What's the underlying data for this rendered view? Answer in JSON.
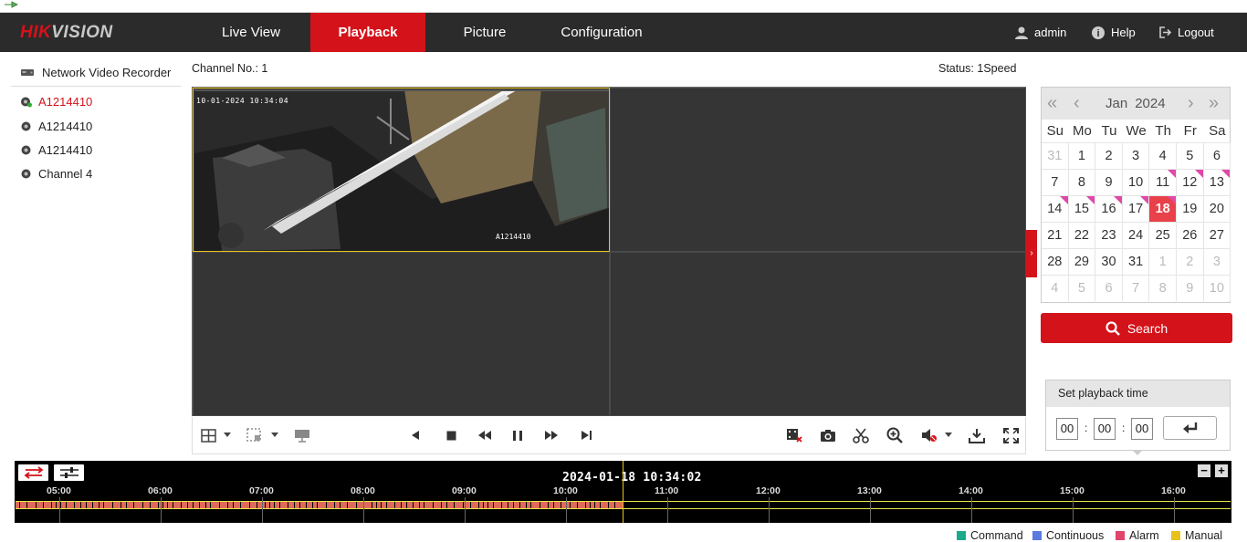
{
  "brand": {
    "logo": "HIKVISION"
  },
  "nav": {
    "tabs": [
      {
        "label": "Live View"
      },
      {
        "label": "Playback"
      },
      {
        "label": "Picture"
      },
      {
        "label": "Configuration"
      }
    ],
    "user": "admin",
    "help": "Help",
    "logout": "Logout"
  },
  "tree": {
    "root": "Network Video Recorder",
    "items": [
      {
        "label": "A1214410"
      },
      {
        "label": "A1214410"
      },
      {
        "label": "A1214410"
      },
      {
        "label": "Channel 4"
      }
    ]
  },
  "channel_no": "Channel No.: 1",
  "status": "Status: 1Speed",
  "video": {
    "osd_time": "10-01-2024 10:34:04",
    "osd_name": "A1214410"
  },
  "calendar": {
    "month": "Jan",
    "year": "2024",
    "weekdays": [
      "Su",
      "Mo",
      "Tu",
      "We",
      "Th",
      "Fr",
      "Sa"
    ],
    "days": [
      {
        "d": "31",
        "other": true
      },
      {
        "d": "1"
      },
      {
        "d": "2"
      },
      {
        "d": "3"
      },
      {
        "d": "4"
      },
      {
        "d": "5"
      },
      {
        "d": "6"
      },
      {
        "d": "7"
      },
      {
        "d": "8"
      },
      {
        "d": "9"
      },
      {
        "d": "10"
      },
      {
        "d": "11",
        "rec": true
      },
      {
        "d": "12",
        "rec": true
      },
      {
        "d": "13",
        "rec": true
      },
      {
        "d": "14",
        "rec": true
      },
      {
        "d": "15",
        "rec": true
      },
      {
        "d": "16",
        "rec": true
      },
      {
        "d": "17",
        "rec": true
      },
      {
        "d": "18",
        "rec": true,
        "selected": true
      },
      {
        "d": "19"
      },
      {
        "d": "20"
      },
      {
        "d": "21"
      },
      {
        "d": "22"
      },
      {
        "d": "23"
      },
      {
        "d": "24"
      },
      {
        "d": "25"
      },
      {
        "d": "26"
      },
      {
        "d": "27"
      },
      {
        "d": "28"
      },
      {
        "d": "29"
      },
      {
        "d": "30"
      },
      {
        "d": "31"
      },
      {
        "d": "1",
        "other": true
      },
      {
        "d": "2",
        "other": true
      },
      {
        "d": "3",
        "other": true
      },
      {
        "d": "4",
        "other": true
      },
      {
        "d": "5",
        "other": true
      },
      {
        "d": "6",
        "other": true
      },
      {
        "d": "7",
        "other": true
      },
      {
        "d": "8",
        "other": true
      },
      {
        "d": "9",
        "other": true
      },
      {
        "d": "10",
        "other": true
      }
    ]
  },
  "search": {
    "label": "Search"
  },
  "playback_time": {
    "title": "Set playback time",
    "hh": "00",
    "mm": "00",
    "ss": "00",
    "sep": ":"
  },
  "timeline": {
    "current": "2024-01-18 10:34:02",
    "hours": [
      "05:00",
      "06:00",
      "07:00",
      "08:00",
      "09:00",
      "10:00",
      "11:00",
      "12:00",
      "13:00",
      "14:00",
      "15:00",
      "16:00"
    ],
    "zoom_out": "−",
    "zoom_in": "+"
  },
  "legend": [
    {
      "label": "Command",
      "color": "#1aaa8a"
    },
    {
      "label": "Continuous",
      "color": "#5a7ae0"
    },
    {
      "label": "Alarm",
      "color": "#e0446a"
    },
    {
      "label": "Manual",
      "color": "#e8c21a"
    }
  ],
  "colors": {
    "accent": "#d4121a",
    "record": "#e06a5a"
  }
}
